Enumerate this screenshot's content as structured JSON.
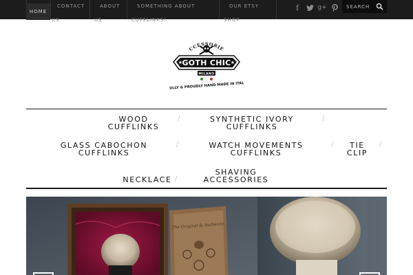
{
  "topbar": {
    "home_label": "HOME",
    "nav": [
      {
        "line1": "CONTACT",
        "line2": "US"
      },
      {
        "line1": "ABOUT",
        "line2": "US"
      },
      {
        "line1": "SOMETHING ABOUT",
        "line2": "CUFFLINKS!"
      },
      {
        "line1": "OUR ETSY",
        "line2": "SHOP"
      }
    ],
    "social_icons": [
      "facebook-icon",
      "twitter-icon",
      "google-plus-icon",
      "pinterest-icon"
    ],
    "search_placeholder": "SEARCH"
  },
  "logo": {
    "top_text": "ACCESSORIES",
    "name": "GOTH CHIC",
    "city": "MILANO",
    "tagline": "FULLY & PROUDLY HAND MADE IN ITALY"
  },
  "menu": {
    "row1": [
      {
        "line1": "WOOD",
        "line2": "CUFFLINKS"
      },
      {
        "line1": "SYNTHETIC IVORY",
        "line2": "CUFFLINKS"
      }
    ],
    "row2": [
      {
        "line1": "GLASS CABOCHON",
        "line2": "CUFFLINKS"
      },
      {
        "line1": "WATCH MOVEMENTS",
        "line2": "CUFFLINKS"
      },
      {
        "line1": "TIE",
        "line2": "CLIP"
      }
    ],
    "row3": [
      {
        "line1": "NECKLACE"
      },
      {
        "line1": "SHAVING",
        "line2": "ACCESSORIES"
      }
    ],
    "separator": "/"
  },
  "colors": {
    "topbar_bg": "#1c1c1c",
    "text_dark": "#111111",
    "italy_green": "#2e8b3e",
    "italy_red": "#c0392b"
  }
}
